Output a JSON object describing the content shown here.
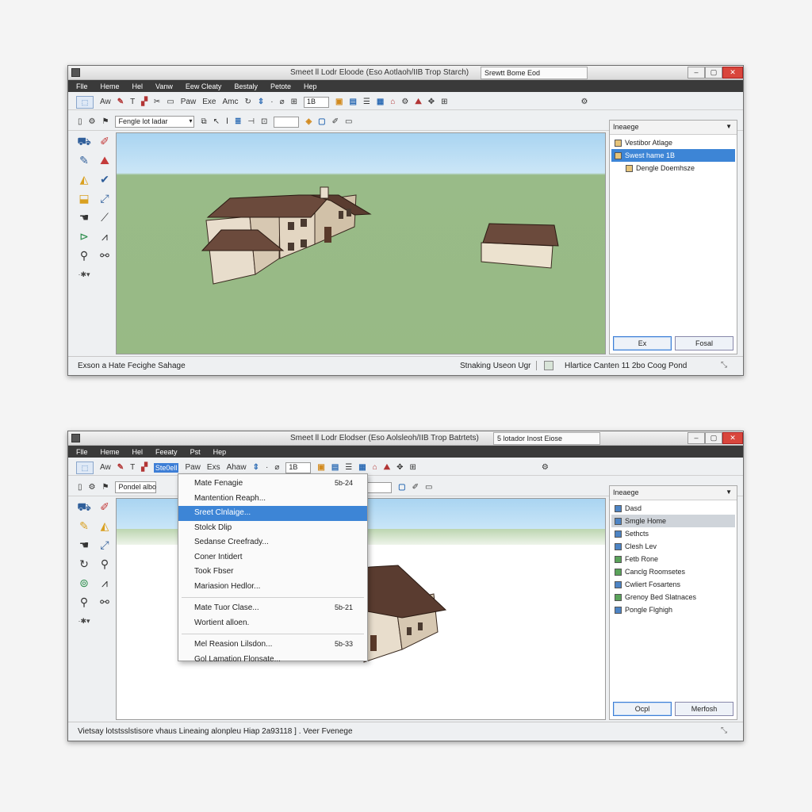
{
  "window1": {
    "title": "Smeet ll Lodr Eloode (Eso Aotlaoh/IIB Trop Starch)",
    "title_tab": "Srewtt Bome Eod",
    "menu": [
      "Flle",
      "Heme",
      "Hel",
      "Vanw",
      "Eew Cleaty",
      "Bestaly",
      "Petote",
      "Hep"
    ],
    "toolbar1": [
      "Aw",
      "Paw",
      "Exe",
      "Amc"
    ],
    "toolbar1_field": "1B",
    "toolbar2": {
      "style_select": "Fengle lot ladar",
      "field": ""
    },
    "sidepanel": {
      "header": "Ineaege",
      "items": [
        "Vestibor Atlage",
        "Swest hame 1B",
        "Dengle Doemhsze"
      ],
      "buttons": [
        "Ex",
        "Fosal"
      ]
    },
    "status": {
      "left": "Exson a Hate Fecighe Sahage",
      "mid": "Stnaking Useon Ugr",
      "right": "Hlartice Canten 11 2bo Coog Pond"
    }
  },
  "window2": {
    "title": "Smeet ll Lodr Elodser (Eso Aolsleoh/IIB Trop Batrtets)",
    "title_tab": "5 lotador Inost Eiose",
    "menu": [
      "Flle",
      "Heme",
      "Hel",
      "Feeaty",
      "Pst",
      "Hep"
    ],
    "toolbar1": [
      "Aw",
      "Ste0ell",
      "Paw",
      "Exs",
      "Ahaw"
    ],
    "toolbar1_field": "1B",
    "toolbar2": {
      "style_select": "Pondel albo"
    },
    "dropdown": {
      "group1": [
        {
          "label": "Mate Fenagie",
          "shortcut": "5b-24"
        },
        {
          "label": "Mantention Reaph...",
          "shortcut": ""
        },
        {
          "label": "Sreet Clnlaige...",
          "shortcut": ""
        },
        {
          "label": "Stolck Dlip",
          "shortcut": ""
        },
        {
          "label": "Sedanse Creefrady...",
          "shortcut": ""
        },
        {
          "label": "Coner Intidert",
          "shortcut": ""
        },
        {
          "label": "Took Fbser",
          "shortcut": ""
        },
        {
          "label": "Mariasion Hedlor...",
          "shortcut": ""
        }
      ],
      "group2": [
        {
          "label": "Mate Tuor Clase...",
          "shortcut": "5b-21"
        },
        {
          "label": "Wortient alloen.",
          "shortcut": ""
        }
      ],
      "group3": [
        {
          "label": "Mel Reasion Lilsdon...",
          "shortcut": "5b-33"
        },
        {
          "label": "Gol Lamation Flonsate...",
          "shortcut": ""
        }
      ]
    },
    "sidepanel": {
      "header": "Ineaege",
      "items": [
        "Dasd",
        "Smgle Home",
        "Sethcts",
        "Clesh Lev",
        "Fetb Rone",
        "Canclg Roomsetes",
        "Cwliert Fosartens",
        "Grenoy Bed Slatnaces",
        "Pongle Flghigh"
      ],
      "buttons": [
        "Ocpl",
        "Merfosh"
      ]
    },
    "status": {
      "left": "Vietsay lotstsslstisore vhaus Lineaing alonpleu Hiap 2a93118 ] . Veer Fvenege"
    }
  },
  "colors": {
    "accent": "#3d85d6",
    "menubar": "#3a3a3a",
    "close": "#d9463c"
  }
}
